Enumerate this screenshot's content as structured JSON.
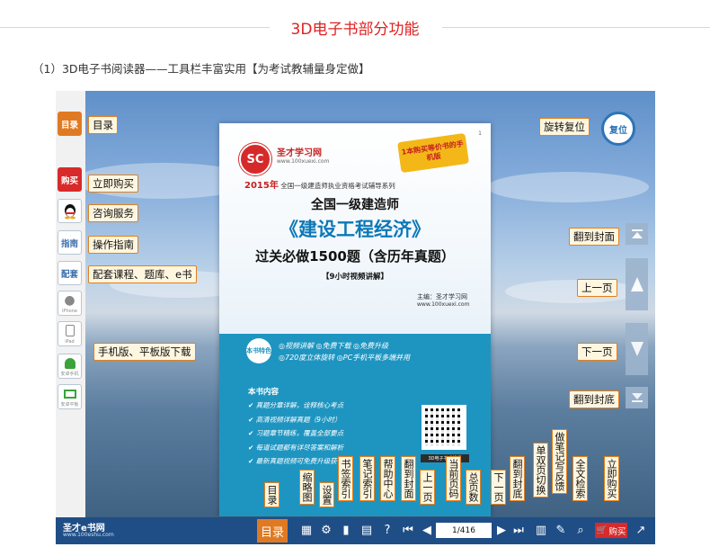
{
  "header": {
    "title": "3D电子书部分功能"
  },
  "subtitle": "（1）3D电子书阅读器——工具栏丰富实用【为考试教辅量身定做】",
  "left_buttons": [
    {
      "label": "目录",
      "sub": ""
    },
    {
      "label": "购买",
      "sub": ""
    },
    {
      "label": "",
      "sub": ""
    },
    {
      "label": "指南",
      "sub": ""
    },
    {
      "label": "配套",
      "sub": ""
    },
    {
      "label": "",
      "sub": "iPhone"
    },
    {
      "label": "",
      "sub": "iPad"
    },
    {
      "label": "",
      "sub": "安卓手机"
    },
    {
      "label": "",
      "sub": "安卓平板"
    }
  ],
  "left_tags": [
    "目录",
    "立即购买",
    "咨询服务",
    "操作指南",
    "配套课程、题库、e书",
    "手机版、平板版下载"
  ],
  "right_tags": [
    "旋转复位",
    "翻到封面",
    "上一页",
    "下一页",
    "翻到封底"
  ],
  "reset_label": "复位",
  "bottom_tags": [
    "目录",
    "缩略图",
    "设置",
    "书签索引",
    "笔记索引",
    "帮助中心",
    "翻到封面",
    "上一页",
    "当前页码",
    "总页数",
    "下一页",
    "翻到封底",
    "单双页切换",
    "做笔记写反馈",
    "全文检索",
    "立即购买"
  ],
  "book": {
    "publisher": "圣才学习网",
    "publisher_url": "www.100xuexi.com",
    "logo": "SC",
    "badge": "1本购买等价书的手机版",
    "page_corner": "1",
    "series_year": "2015年",
    "series_text": "全国一级建造师执业资格考试辅导系列",
    "title1": "全国一级建造师",
    "title2": "《建设工程经济》",
    "title3": "过关必做1500题（含历年真题）",
    "title4": "【9小时视频讲解】",
    "editor": "主编：圣才学习网",
    "editor_url": "www.100xuexi.com",
    "feature_badge": "本书特色",
    "features1": "◎视频讲解 ◎免费下载 ◎免费升级",
    "features2": "◎720度立体旋转 ◎PC手机平板多端并用",
    "contents_title": "本书内容",
    "contents": [
      "✔ 真题分章详解，诠释核心考点",
      "✔ 高清视频详解真题（9小时）",
      "✔ 习题章节精练，覆盖全部要点",
      "✔ 每道试题都有详尽答案和解析",
      "✔ 最新真题视频可免费升级获得"
    ],
    "qr_caption": "3D电子书手机版"
  },
  "toolbar": {
    "brand": "圣才e书网",
    "brand_url": "www.100eshu.com",
    "toc_label": "目录",
    "page": "1/416",
    "buy_label": "购买"
  },
  "colors": {
    "accent": "#e02020",
    "toolbar": "#1f4e86",
    "tag_border": "#e0801f",
    "cover_blue": "#1e95c1"
  }
}
